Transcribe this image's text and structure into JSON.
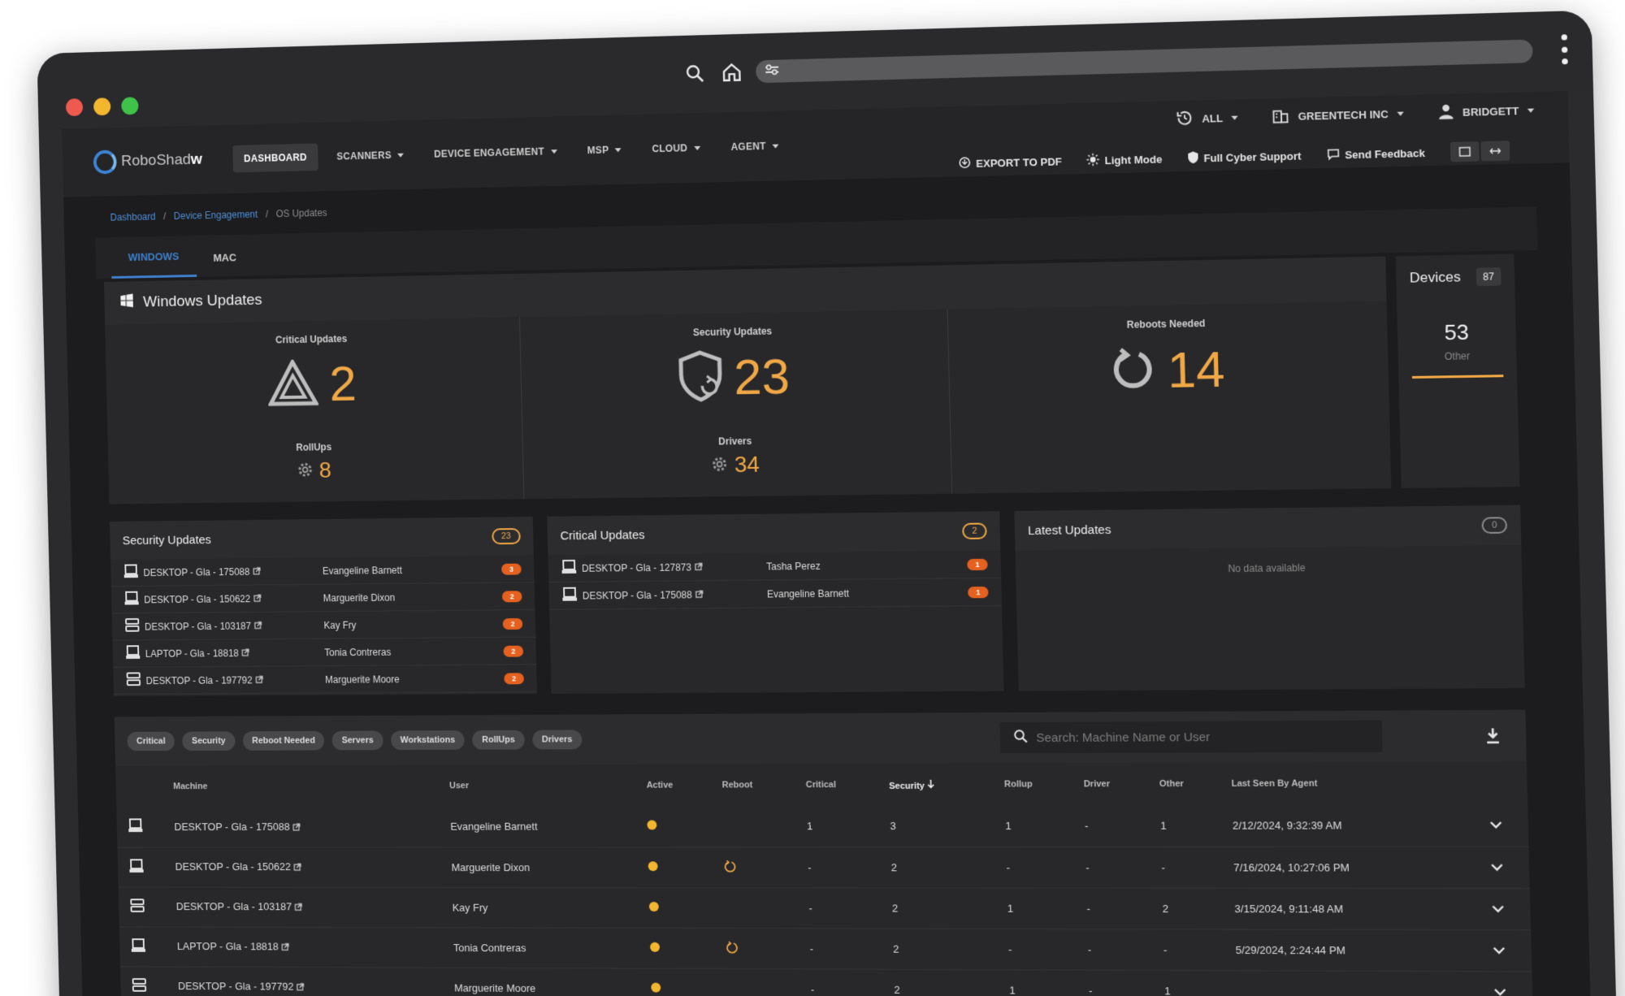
{
  "nav": {
    "logo_prefix": "RoboShad",
    "logo_suffix": "w",
    "items": [
      {
        "label": "DASHBOARD",
        "active": true,
        "caret": false
      },
      {
        "label": "SCANNERS",
        "active": false,
        "caret": true
      },
      {
        "label": "DEVICE ENGAGEMENT",
        "active": false,
        "caret": true
      },
      {
        "label": "MSP",
        "active": false,
        "caret": true
      },
      {
        "label": "CLOUD",
        "active": false,
        "caret": true
      },
      {
        "label": "AGENT",
        "active": false,
        "caret": true
      }
    ],
    "scope_label": "ALL",
    "org_label": "GREENTECH INC",
    "user_label": "BRIDGETT"
  },
  "toolbar": {
    "export_label": "EXPORT TO PDF",
    "light_mode_label": "Light Mode",
    "support_label": "Full Cyber Support",
    "feedback_label": "Send Feedback"
  },
  "breadcrumb": [
    "Dashboard",
    "Device Engagement",
    "OS Updates"
  ],
  "tabs": [
    "WINDOWS",
    "MAC"
  ],
  "windows_updates": {
    "title": "Windows Updates",
    "critical_label": "Critical Updates",
    "critical_value": "2",
    "security_label": "Security Updates",
    "security_value": "23",
    "reboots_label": "Reboots Needed",
    "reboots_value": "14",
    "rollups_label": "RollUps",
    "rollups_value": "8",
    "drivers_label": "Drivers",
    "drivers_value": "34"
  },
  "devices": {
    "title": "Devices",
    "count": "87",
    "value": "53",
    "label": "Other"
  },
  "security_card": {
    "title": "Security Updates",
    "count": "23",
    "rows": [
      {
        "machine": "DESKTOP - Gla - 175088",
        "user": "Evangeline Barnett",
        "badge": "3",
        "icon": "laptop"
      },
      {
        "machine": "DESKTOP - Gla - 150622",
        "user": "Marguerite Dixon",
        "badge": "2",
        "icon": "laptop"
      },
      {
        "machine": "DESKTOP - Gla - 103187",
        "user": "Kay Fry",
        "badge": "2",
        "icon": "server"
      },
      {
        "machine": "LAPTOP - Gla - 18818",
        "user": "Tonia Contreras",
        "badge": "2",
        "icon": "laptop"
      },
      {
        "machine": "DESKTOP - Gla - 197792",
        "user": "Marguerite Moore",
        "badge": "2",
        "icon": "server"
      }
    ]
  },
  "critical_card": {
    "title": "Critical Updates",
    "count": "2",
    "rows": [
      {
        "machine": "DESKTOP - Gla - 127873",
        "user": "Tasha Perez",
        "badge": "1",
        "icon": "laptop"
      },
      {
        "machine": "DESKTOP - Gla - 175088",
        "user": "Evangeline Barnett",
        "badge": "1",
        "icon": "laptop"
      }
    ]
  },
  "latest_card": {
    "title": "Latest Updates",
    "count": "0",
    "empty": "No data available"
  },
  "filters": [
    "Critical",
    "Security",
    "Reboot Needed",
    "Servers",
    "Workstations",
    "RollUps",
    "Drivers"
  ],
  "search": {
    "placeholder": "Search: Machine Name or User"
  },
  "table": {
    "columns": [
      "Machine",
      "User",
      "Active",
      "Reboot",
      "Critical",
      "Security",
      "Rollup",
      "Driver",
      "Other",
      "Last Seen By Agent"
    ],
    "sorted_column": "Security",
    "rows": [
      {
        "icon": "laptop",
        "machine": "DESKTOP - Gla - 175088",
        "user": "Evangeline Barnett",
        "reboot": false,
        "critical": "1",
        "security": "3",
        "rollup": "1",
        "driver": "-",
        "other": "1",
        "last_seen": "2/12/2024, 9:32:39 AM"
      },
      {
        "icon": "laptop",
        "machine": "DESKTOP - Gla - 150622",
        "user": "Marguerite Dixon",
        "reboot": true,
        "critical": "-",
        "security": "2",
        "rollup": "-",
        "driver": "-",
        "other": "-",
        "last_seen": "7/16/2024, 10:27:06 PM"
      },
      {
        "icon": "server",
        "machine": "DESKTOP - Gla - 103187",
        "user": "Kay Fry",
        "reboot": false,
        "critical": "-",
        "security": "2",
        "rollup": "1",
        "driver": "-",
        "other": "2",
        "last_seen": "3/15/2024, 9:11:48 AM"
      },
      {
        "icon": "laptop",
        "machine": "LAPTOP - Gla - 18818",
        "user": "Tonia Contreras",
        "reboot": true,
        "critical": "-",
        "security": "2",
        "rollup": "-",
        "driver": "-",
        "other": "-",
        "last_seen": "5/29/2024, 2:24:44 PM"
      },
      {
        "icon": "server",
        "machine": "DESKTOP - Gla - 197792",
        "user": "Marguerite Moore",
        "reboot": false,
        "critical": "-",
        "security": "2",
        "rollup": "1",
        "driver": "-",
        "other": "1",
        "last_seen": ""
      }
    ]
  },
  "colors": {
    "accent": "#f0a846",
    "badge": "#e5611f",
    "active_tab": "#3f7fcb",
    "active_dot": "#f3b62f"
  },
  "icons": [
    "search-icon",
    "home-icon",
    "history-icon",
    "building-icon",
    "user-icon",
    "windows-icon",
    "warning-icon",
    "shield-sync-icon",
    "refresh-icon",
    "gear-icon",
    "laptop-icon",
    "server-icon",
    "external-link-icon",
    "download-icon",
    "chevron-down-icon",
    "sun-icon",
    "shield-icon",
    "chat-icon"
  ]
}
